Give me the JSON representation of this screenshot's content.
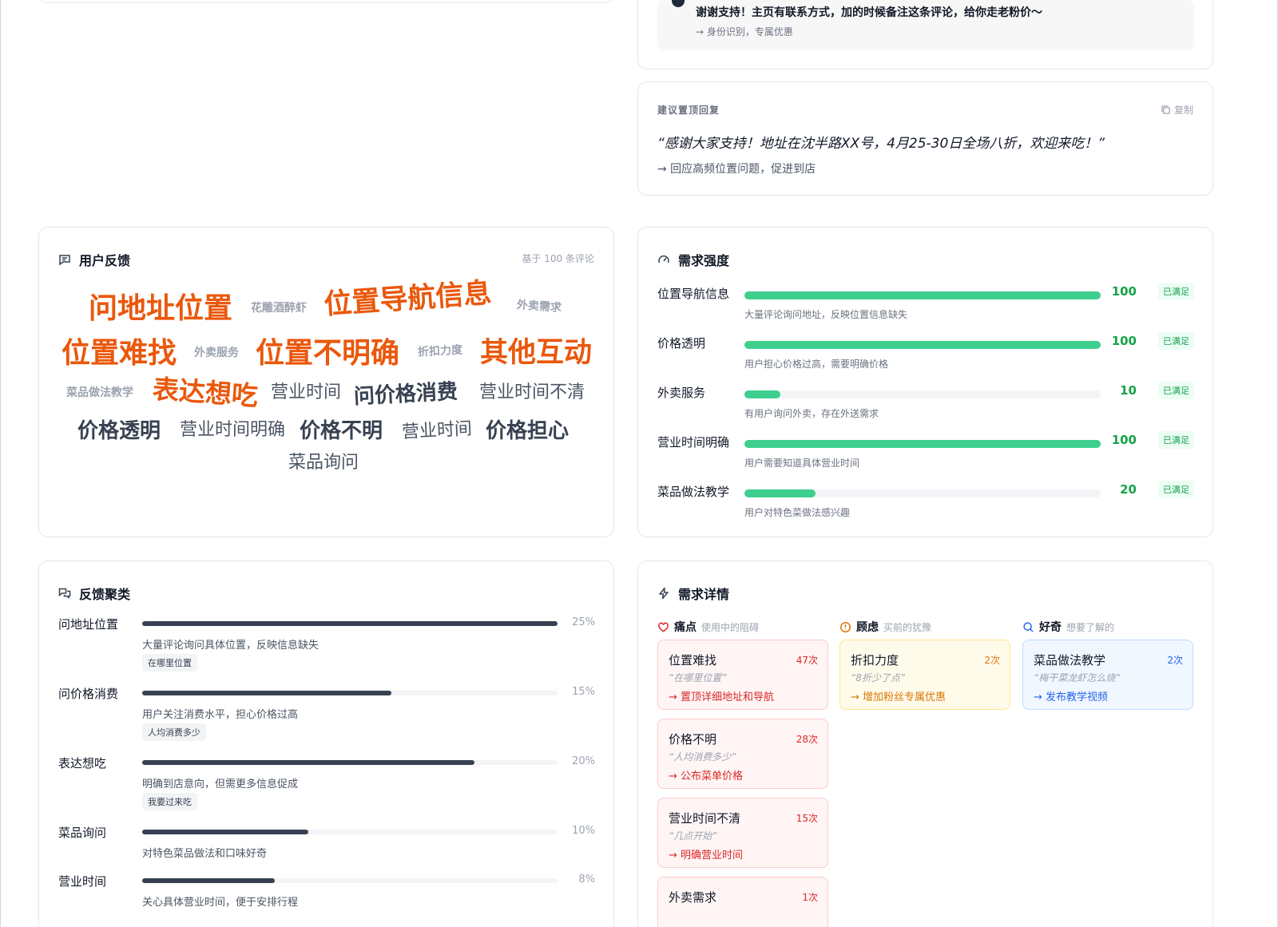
{
  "top_reply": {
    "text": "谢谢支持！主页有联系方式，加的时候备注这条评论，给你走老粉价～",
    "note": "→ 身份识别，专属优惠"
  },
  "pinned_reply": {
    "label": "建议置顶回复",
    "copy_label": "复制",
    "quote": "“感谢大家支持！地址在沈半路XX号，4月25-30日全场八折，欢迎来吃！”",
    "note": "→ 回应高频位置问题，促进到店"
  },
  "user_feedback": {
    "title": "用户反馈",
    "basis": "基于 100 条评论",
    "words": [
      {
        "text": "问地址位置",
        "tone": "hot"
      },
      {
        "text": "花雕酒醉虾",
        "tone": "light"
      },
      {
        "text": "位置导航信息",
        "tone": "hot"
      },
      {
        "text": "外卖需求",
        "tone": "light"
      },
      {
        "text": "位置难找",
        "tone": "hot"
      },
      {
        "text": "外卖服务",
        "tone": "light"
      },
      {
        "text": "位置不明确",
        "tone": "hot"
      },
      {
        "text": "折扣力度",
        "tone": "light"
      },
      {
        "text": "其他互动",
        "tone": "hot"
      },
      {
        "text": "菜品做法教学",
        "tone": "light"
      },
      {
        "text": "表达想吃",
        "tone": "hot"
      },
      {
        "text": "营业时间",
        "tone": "mid"
      },
      {
        "text": "问价格消费",
        "tone": "dark"
      },
      {
        "text": "营业时间不清",
        "tone": "mid"
      },
      {
        "text": "价格透明",
        "tone": "dark"
      },
      {
        "text": "营业时间明确",
        "tone": "mid"
      },
      {
        "text": "价格不明",
        "tone": "dark"
      },
      {
        "text": "营业时间",
        "tone": "mid"
      },
      {
        "text": "价格担心",
        "tone": "dark"
      },
      {
        "text": "菜品询问",
        "tone": "mid"
      }
    ]
  },
  "demand_intensity": {
    "title": "需求强度",
    "items": [
      {
        "name": "位置导航信息",
        "value": 100,
        "desc": "大量评论询问地址，反映位置信息缺失",
        "status": "已满足"
      },
      {
        "name": "价格透明",
        "value": 100,
        "desc": "用户担心价格过高，需要明确价格",
        "status": "已满足"
      },
      {
        "name": "外卖服务",
        "value": 10,
        "desc": "有用户询问外卖，存在外送需求",
        "status": "已满足"
      },
      {
        "name": "营业时间明确",
        "value": 100,
        "desc": "用户需要知道具体营业时间",
        "status": "已满足"
      },
      {
        "name": "菜品做法教学",
        "value": 20,
        "desc": "用户对特色菜做法感兴趣",
        "status": "已满足"
      }
    ]
  },
  "clusters": {
    "title": "反馈聚类",
    "items": [
      {
        "name": "问地址位置",
        "pct_label": "25%",
        "bar": 1.0,
        "desc": "大量评论询问具体位置，反映信息缺失",
        "tag": "在哪里位置"
      },
      {
        "name": "问价格消费",
        "pct_label": "15%",
        "bar": 0.6,
        "desc": "用户关注消费水平，担心价格过高",
        "tag": "人均消费多少"
      },
      {
        "name": "表达想吃",
        "pct_label": "20%",
        "bar": 0.8,
        "desc": "明确到店意向，但需更多信息促成",
        "tag": "我要过来吃"
      },
      {
        "name": "菜品询问",
        "pct_label": "10%",
        "bar": 0.4,
        "desc": "对特色菜品做法和口味好奇",
        "tag": ""
      },
      {
        "name": "营业时间",
        "pct_label": "8%",
        "bar": 0.32,
        "desc": "关心具体营业时间，便于安排行程",
        "tag": ""
      }
    ]
  },
  "needs_detail": {
    "title": "需求详情",
    "columns": [
      {
        "name": "痛点",
        "sub": "使用中的阻碍",
        "tone": "red",
        "icon": "heart-icon",
        "items": [
          {
            "title": "位置难找",
            "count": "47次",
            "quote": "“在哪里位置”",
            "action": "→ 置顶详细地址和导航"
          },
          {
            "title": "价格不明",
            "count": "28次",
            "quote": "“人均消费多少”",
            "action": "→ 公布菜单价格"
          },
          {
            "title": "营业时间不清",
            "count": "15次",
            "quote": "“几点开始”",
            "action": "→ 明确营业时间"
          },
          {
            "title": "外卖需求",
            "count": "1次",
            "quote": "",
            "action": ""
          }
        ]
      },
      {
        "name": "顾虑",
        "sub": "买前的犹豫",
        "tone": "amber",
        "icon": "alert-icon",
        "items": [
          {
            "title": "折扣力度",
            "count": "2次",
            "quote": "“8折少了点”",
            "action": "→ 增加粉丝专属优惠"
          }
        ]
      },
      {
        "name": "好奇",
        "sub": "想要了解的",
        "tone": "blue",
        "icon": "search-icon",
        "items": [
          {
            "title": "菜品做法教学",
            "count": "2次",
            "quote": "“梅干菜龙虾怎么烧”",
            "action": "→ 发布教学视频"
          }
        ]
      }
    ]
  }
}
